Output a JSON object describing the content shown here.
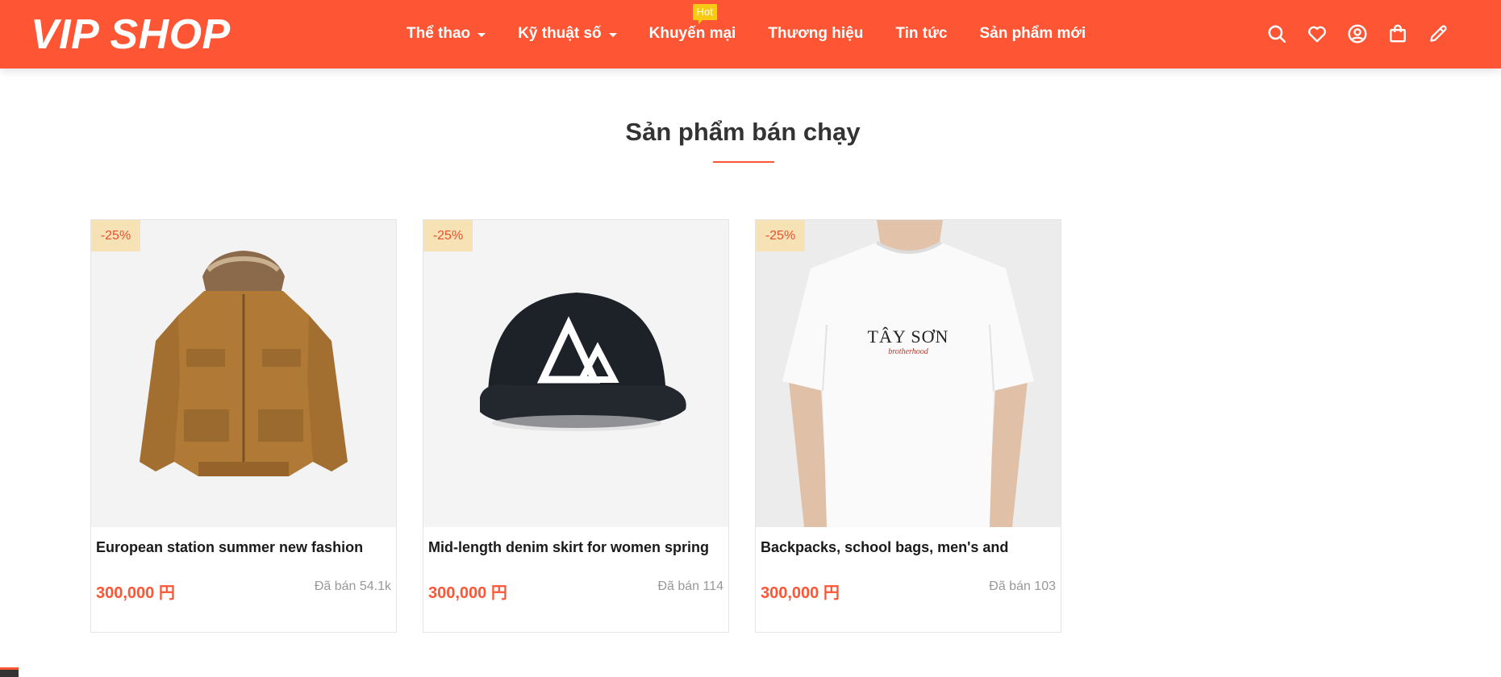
{
  "header": {
    "logo": "VIP SHOP",
    "nav": [
      {
        "label": "Thể thao",
        "dropdown": true
      },
      {
        "label": "Kỹ thuật số",
        "dropdown": true
      },
      {
        "label": "Khuyến mại",
        "badge": "Hot"
      },
      {
        "label": "Thương hiệu"
      },
      {
        "label": "Tin tức"
      },
      {
        "label": "Sản phẩm mới"
      }
    ],
    "icons": [
      "search-icon",
      "heart-icon",
      "user-icon",
      "shopping-bag-icon",
      "pencil-icon"
    ]
  },
  "section": {
    "title": "Sản phẩm bán chạy"
  },
  "products": [
    {
      "discount": "-25%",
      "name": "European station summer new fashion",
      "price": "300,000 円",
      "sold": "Đã bán 54.1k",
      "image": "brown-hooded-jacket"
    },
    {
      "discount": "-25%",
      "name": "Mid-length denim skirt for women spring",
      "price": "300,000 円",
      "sold": "Đã bán 114",
      "image": "black-cap-mountain-logo"
    },
    {
      "discount": "-25%",
      "name": "Backpacks, school bags, men's and",
      "price": "300,000 円",
      "sold": "Đã bán 103",
      "image": "white-tshirt-tay-son",
      "shirt_text": "TÂY SƠN",
      "shirt_subtext": "brotherhood"
    }
  ],
  "colors": {
    "brand": "#fe5534",
    "badge": "#f8c915",
    "discount_bg": "#f7e2b6"
  }
}
